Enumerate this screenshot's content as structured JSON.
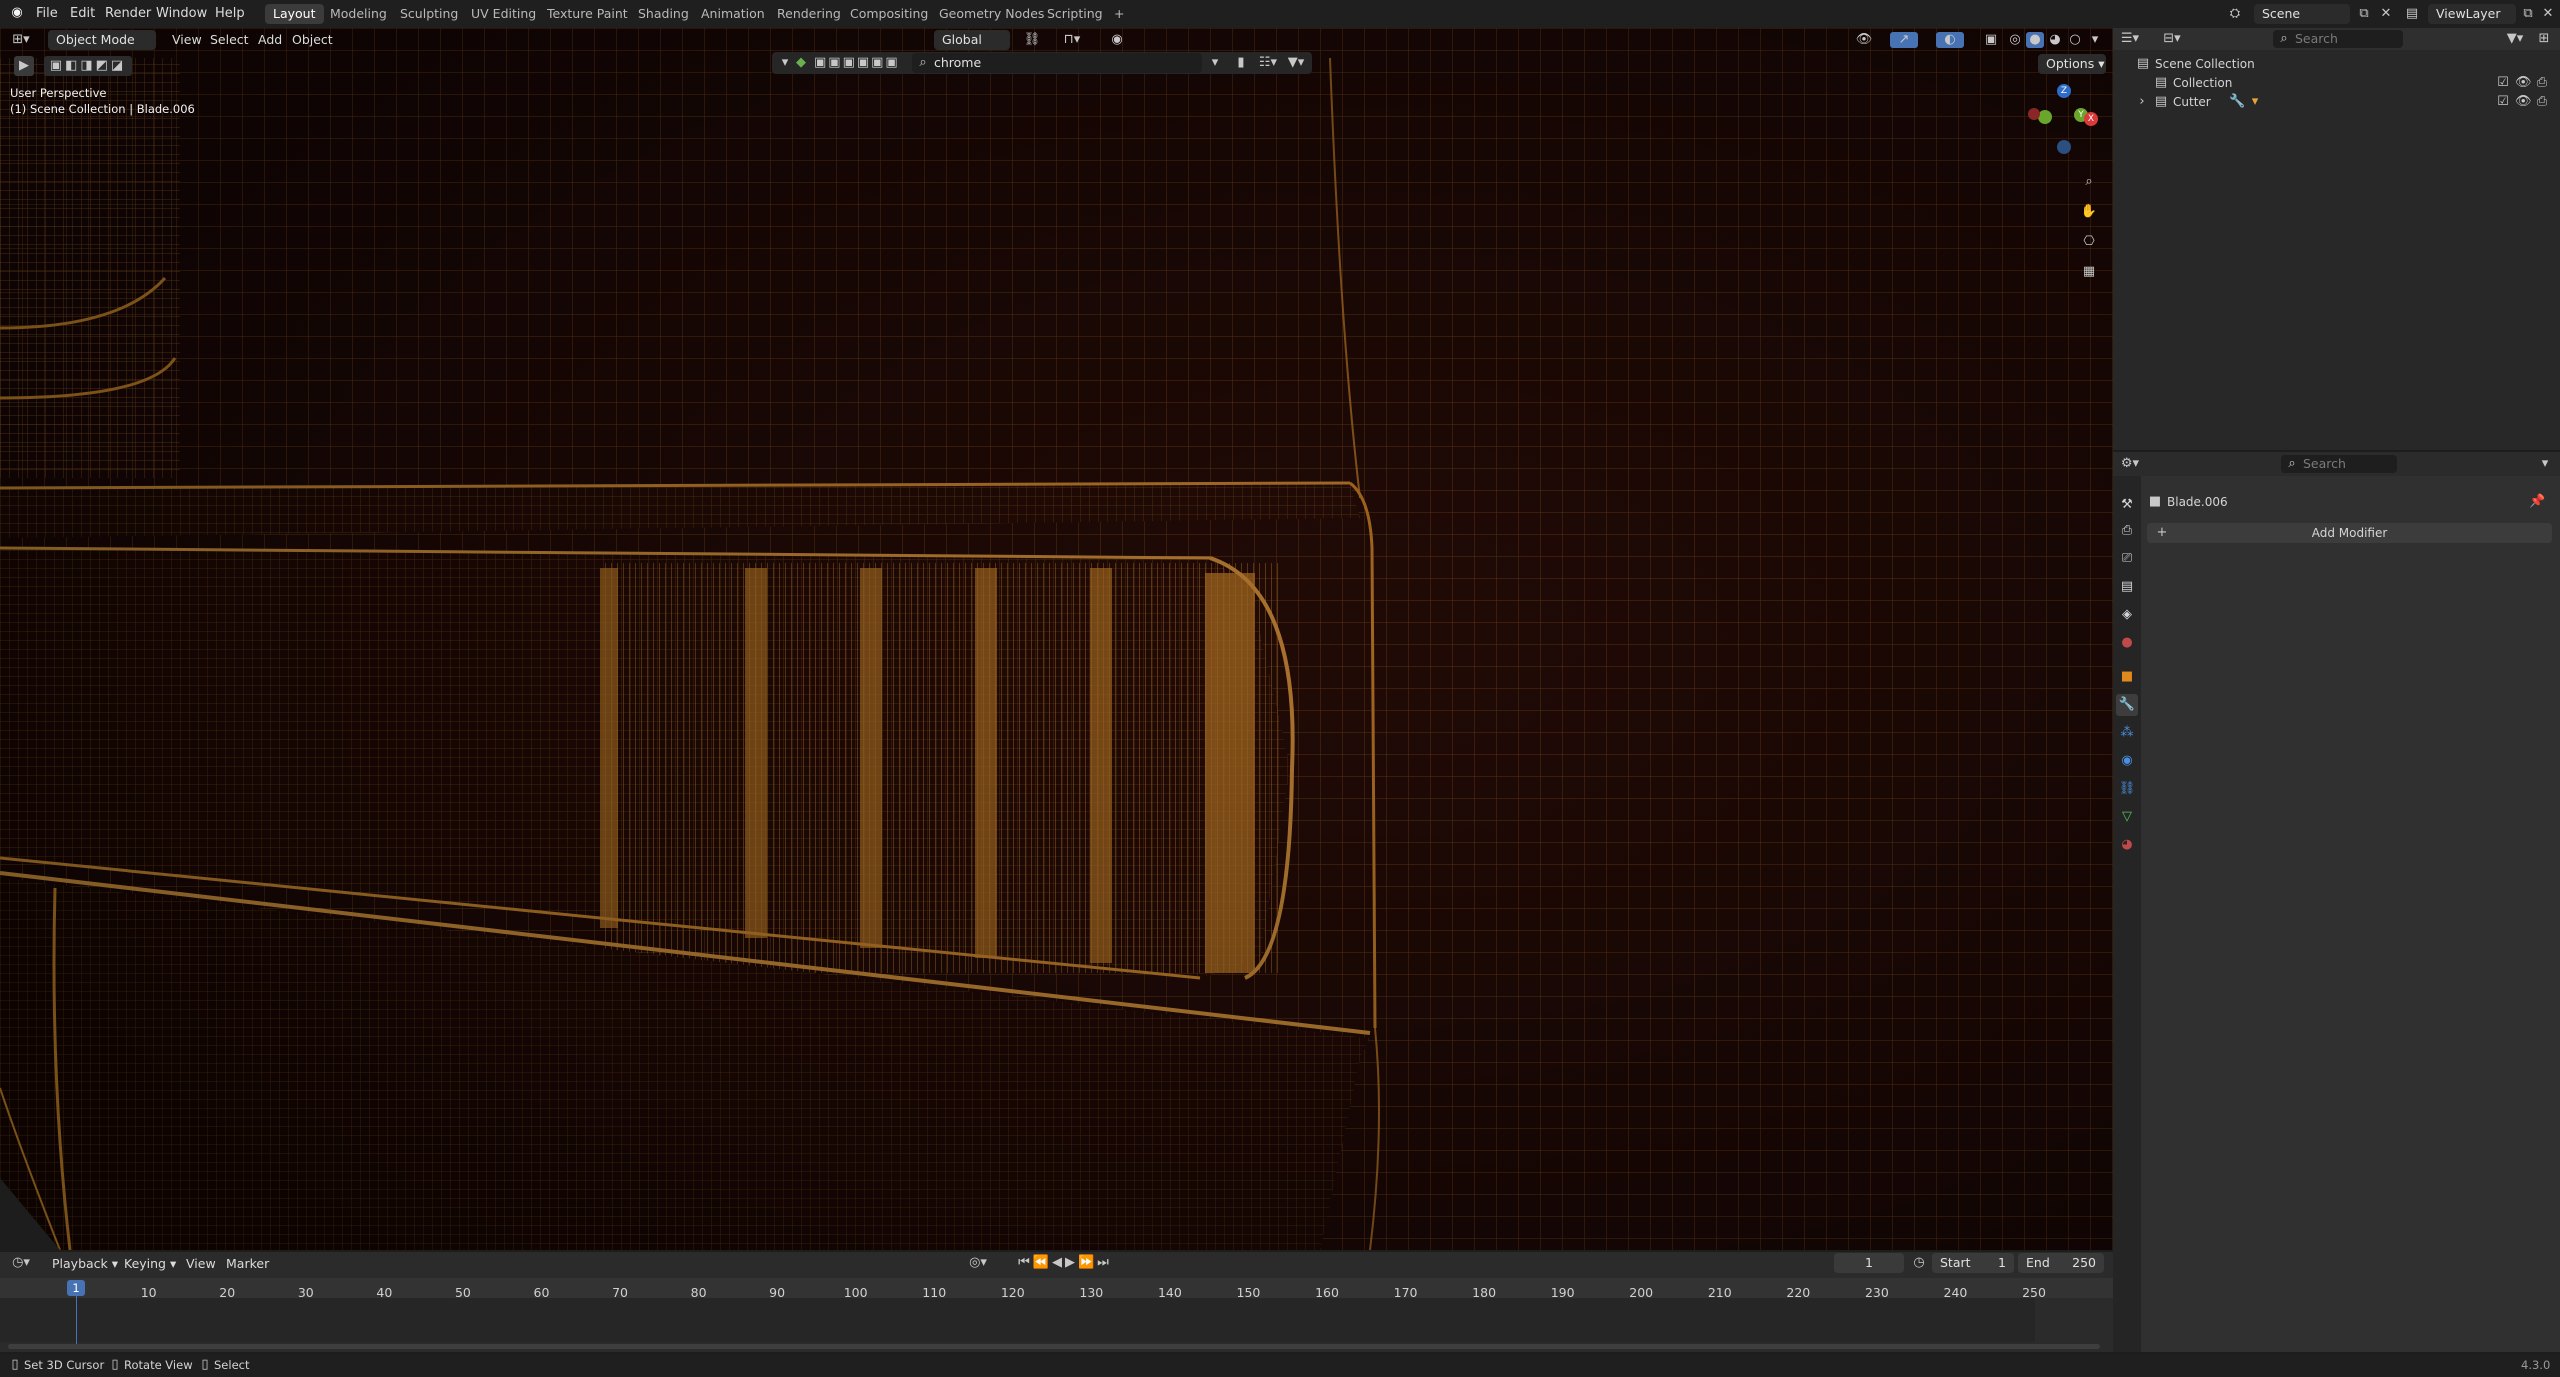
{
  "menubar": {
    "items": [
      "File",
      "Edit",
      "Render",
      "Window",
      "Help"
    ],
    "workspaces": [
      "Layout",
      "Modeling",
      "Sculpting",
      "UV Editing",
      "Texture Paint",
      "Shading",
      "Animation",
      "Rendering",
      "Compositing",
      "Geometry Nodes",
      "Scripting"
    ],
    "active_workspace": "Layout",
    "add_tab": "+",
    "scene": "Scene",
    "view_layer": "ViewLayer"
  },
  "viewport_header": {
    "mode": "Object Mode",
    "menus": [
      "View",
      "Select",
      "Add",
      "Object"
    ],
    "transform_orientation": "Global",
    "search_value": "chrome",
    "options_label": "Options"
  },
  "viewport": {
    "perspective": "User Perspective",
    "collection_info": "(1) Scene Collection | Blade.006",
    "gizmo_axes": [
      "Z",
      "Y",
      "X"
    ]
  },
  "outliner": {
    "search_placeholder": "Search",
    "root": "Scene Collection",
    "items": [
      "Collection",
      "Cutter"
    ]
  },
  "properties": {
    "search_placeholder": "Search",
    "object_name": "Blade.006",
    "add_modifier": "Add Modifier"
  },
  "timeline": {
    "menus": [
      "Playback",
      "Keying",
      "View",
      "Marker"
    ],
    "current_frame": "1",
    "start_label": "Start",
    "start_value": "1",
    "end_label": "End",
    "end_value": "250",
    "ticks": [
      "1",
      "10",
      "20",
      "30",
      "40",
      "50",
      "60",
      "70",
      "80",
      "90",
      "100",
      "110",
      "120",
      "130",
      "140",
      "150",
      "160",
      "170",
      "180",
      "190",
      "200",
      "210",
      "220",
      "230",
      "240",
      "250"
    ]
  },
  "statusbar": {
    "hints": [
      "Set 3D Cursor",
      "Rotate View",
      "Select"
    ],
    "version": "4.3.0"
  },
  "colors": {
    "wire": "#f0a030",
    "viewport_bg": "#170705",
    "active_blue": "#4772b3"
  }
}
